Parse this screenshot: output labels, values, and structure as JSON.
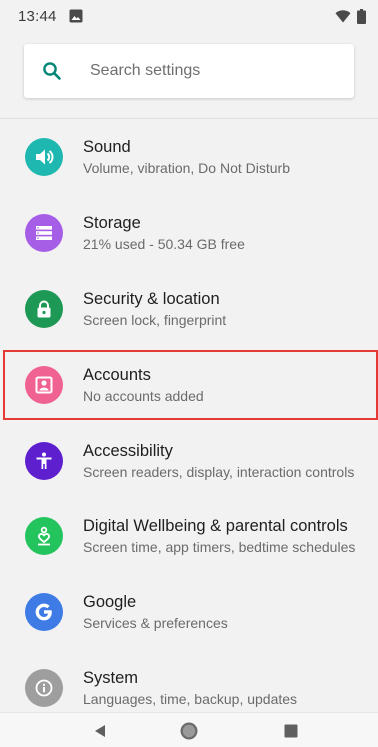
{
  "status_bar": {
    "time": "13:44"
  },
  "search": {
    "placeholder": "Search settings"
  },
  "colors": {
    "accent": "#008577",
    "selection_border": "#e53935"
  },
  "items": [
    {
      "title": "Sound",
      "subtitle": "Volume, vibration, Do Not Disturb",
      "icon": "volume-icon",
      "color": "#1fb8b0"
    },
    {
      "title": "Storage",
      "subtitle": "21% used - 50.34 GB free",
      "icon": "storage-icon",
      "color": "#a75ee6"
    },
    {
      "title": "Security & location",
      "subtitle": "Screen lock, fingerprint",
      "icon": "lock-icon",
      "color": "#1e9955"
    },
    {
      "title": "Accounts",
      "subtitle": "No accounts added",
      "icon": "account-box-icon",
      "color": "#f06292",
      "selected": true
    },
    {
      "title": "Accessibility",
      "subtitle": "Screen readers, display, interaction controls",
      "icon": "accessibility-icon",
      "color": "#5e1fcf"
    },
    {
      "title": "Digital Wellbeing & parental controls",
      "subtitle": "Screen time, app timers, bedtime schedules",
      "icon": "wellbeing-icon",
      "color": "#23c45e"
    },
    {
      "title": "Google",
      "subtitle": "Services & preferences",
      "icon": "google-icon",
      "color": "#3f7be5"
    },
    {
      "title": "System",
      "subtitle": "Languages, time, backup, updates",
      "icon": "info-icon",
      "color": "#9e9e9e"
    }
  ],
  "nav": {
    "back_icon": "back-triangle-icon",
    "home_icon": "home-circle-icon",
    "recents_icon": "recents-square-icon"
  }
}
